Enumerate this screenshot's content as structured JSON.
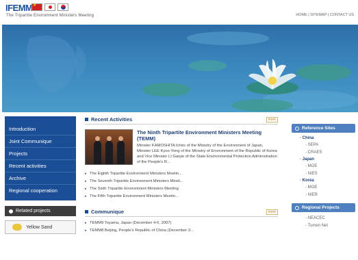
{
  "header": {
    "logo": "IFEMM",
    "subtitle": "The Tripartite Environment Ministers Meeting",
    "top_links": "HOME  |  SITEMAP  |  CONTACT US",
    "flags": [
      "china-flag",
      "japan-flag",
      "korea-flag"
    ]
  },
  "nav": {
    "items": [
      "Introduction",
      "Joint Communique",
      "Projects",
      "Recent activities",
      "Archive",
      "Regional cooperation"
    ],
    "related_label": "Related projects",
    "yellow_sand_label": "Yellow Sand"
  },
  "recent": {
    "title": "Recent Activities",
    "more": "more",
    "feature_title": "The Ninth Tripartite Environment Ministers Meeting (TEMM)",
    "feature_body": "Minister KAMOSHITA Ichiro of the Ministry of the Environment of Japan, Minister LEE Kyoo-Yong of the Ministry of Environment of the Republic of Korea and Vice Minister LI Ganjie of the State Environmental Protection Administration of the People's R...",
    "news": [
      "The Eighth Tripartite Environment Ministers Meetin...",
      "The Seventh Tripartite Environment Ministers Meeti...",
      "The Sixth Tripartite Environment Ministers Meeting",
      "The Fifth Tripartite Environment Ministers Meetin..."
    ]
  },
  "communique": {
    "title": "Communique",
    "more": "more",
    "items": [
      "TEMM9 Toyama, Japan (December 4-6, 2007)",
      "TEMM8 Beijing, People's Republic of China (December 3..."
    ]
  },
  "reference": {
    "title": "Reference Sites",
    "groups": [
      {
        "country": "China",
        "sites": [
          "SEPA",
          "CRAES"
        ]
      },
      {
        "country": "Japan",
        "sites": [
          "MOE",
          "NIES"
        ]
      },
      {
        "country": "Korea",
        "sites": [
          "MOE",
          "NIER"
        ]
      }
    ]
  },
  "regional": {
    "title": "Regional Projects",
    "sites": [
      "NEACEC",
      "Tumen Net"
    ]
  }
}
